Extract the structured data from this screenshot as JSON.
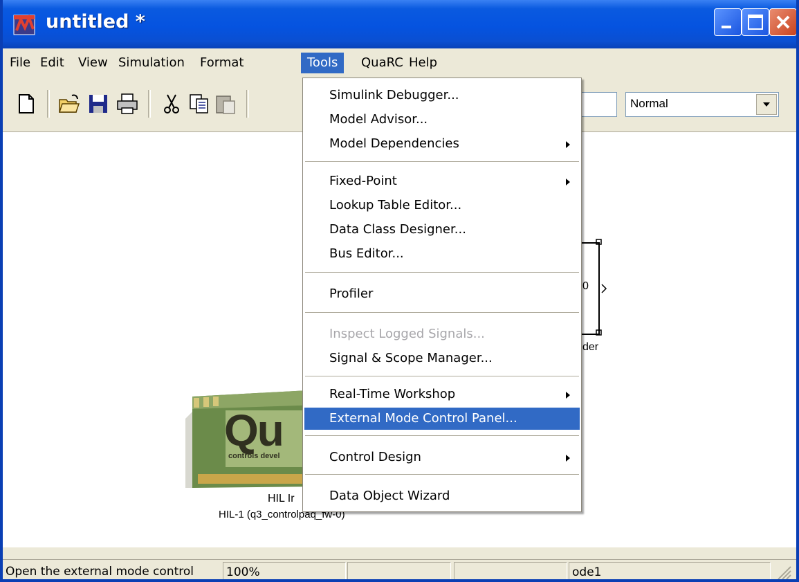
{
  "window": {
    "title": "untitled *"
  },
  "menubar": {
    "items": [
      {
        "label": "File"
      },
      {
        "label": "Edit"
      },
      {
        "label": "View"
      },
      {
        "label": "Simulation"
      },
      {
        "label": "Format"
      },
      {
        "label": "Tools"
      },
      {
        "label": "QuaRC"
      },
      {
        "label": "Help"
      }
    ],
    "active": "Tools"
  },
  "toolbar": {
    "buttons": [
      "new-icon",
      "open-icon",
      "save-icon",
      "print-icon",
      "cut-icon",
      "copy-icon",
      "paste-icon"
    ],
    "simulation_mode": "Normal"
  },
  "tools_menu": {
    "items": [
      {
        "label": "Simulink Debugger..."
      },
      {
        "label": "Model Advisor..."
      },
      {
        "label": "Model Dependencies",
        "submenu": true
      },
      {
        "label": "Fixed-Point",
        "submenu": true
      },
      {
        "label": "Lookup Table Editor..."
      },
      {
        "label": "Data Class Designer..."
      },
      {
        "label": "Bus Editor..."
      },
      {
        "label": "Profiler"
      },
      {
        "label": "Inspect Logged Signals...",
        "disabled": true
      },
      {
        "label": "Signal & Scope Manager..."
      },
      {
        "label": "Real-Time Workshop",
        "submenu": true
      },
      {
        "label": "External Mode Control Panel...",
        "highlighted": true
      },
      {
        "label": "Control Design",
        "submenu": true
      },
      {
        "label": "Data Object Wizard"
      }
    ]
  },
  "canvas": {
    "hil_block": {
      "label_line1": "HIL Ir",
      "label_line2": "HIL-1 (q3_controlpaq_fw-0)",
      "card_text": "Qu",
      "card_subtext": "controls devel"
    },
    "encoder_block": {
      "port_text": "0",
      "label": "der"
    }
  },
  "statusbar": {
    "message": "Open the external mode control",
    "zoom": "100%",
    "solver": "ode1"
  },
  "colors": {
    "titlebar": "#0553e0",
    "highlight": "#316ac5",
    "chrome": "#ece9d8"
  }
}
